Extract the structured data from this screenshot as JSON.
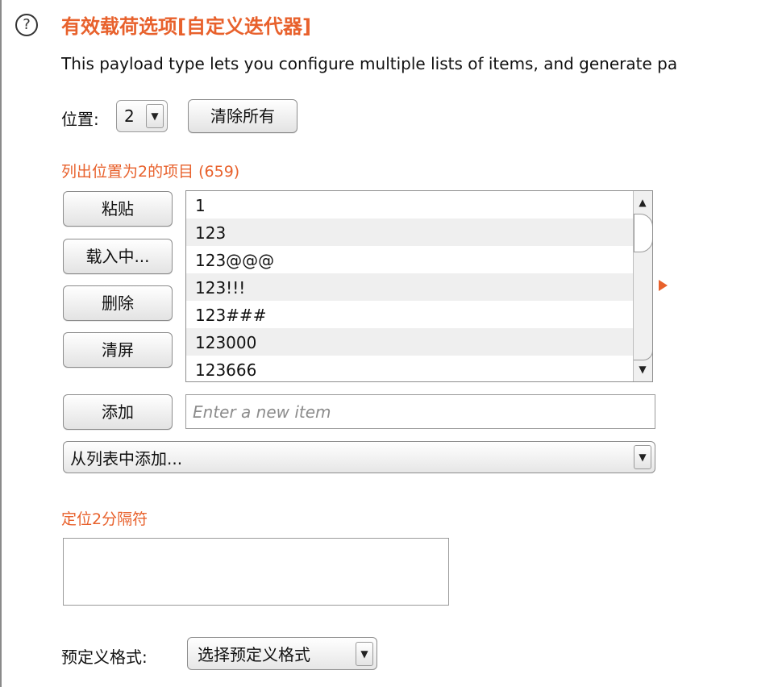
{
  "header": {
    "help_glyph": "?",
    "title": "有效载荷选项[自定义迭代器]",
    "description": "This payload type lets you configure multiple lists of items, and generate pa"
  },
  "position": {
    "label": "位置:",
    "selected": "2",
    "clear_all_label": "清除所有"
  },
  "items_list": {
    "title": "列出位置为2的项目 (659)",
    "items": [
      "1",
      "123",
      "123@@@",
      "123!!!",
      "123###",
      "123000",
      "123666"
    ]
  },
  "buttons": {
    "paste": "粘贴",
    "load": "载入中...",
    "remove": "删除",
    "clear": "清屏",
    "add": "添加"
  },
  "new_item": {
    "value": "",
    "placeholder": "Enter a new item"
  },
  "add_from_list": {
    "selected": "从列表中添加..."
  },
  "delimiter": {
    "title": "定位2分隔符",
    "value": ""
  },
  "predefined_format": {
    "label": "预定义格式:",
    "selected": "选择预定义格式"
  },
  "colors": {
    "accent": "#e8612c"
  },
  "icons": {
    "dropdown": "▼",
    "scroll_up": "▲",
    "scroll_down": "▼"
  }
}
